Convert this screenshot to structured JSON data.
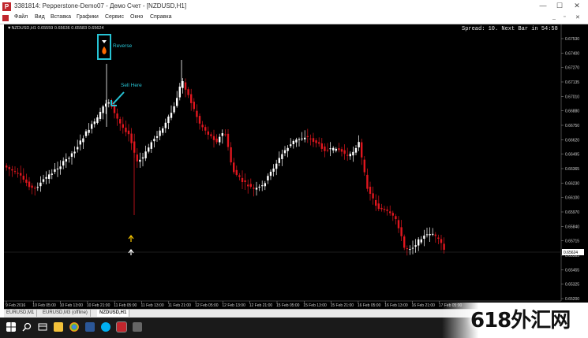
{
  "window": {
    "title": "3381814: Pepperstone-Demo07 - Демо Счет - [NZDUSD,H1]",
    "minimize": "—",
    "maximize": "☐",
    "close": "✕"
  },
  "menu": {
    "items": [
      "Файл",
      "Вид",
      "Вставка",
      "Графики",
      "Сервис",
      "Окно",
      "Справка"
    ],
    "mdi_buttons": [
      "_",
      "▫",
      "✕"
    ]
  },
  "chart": {
    "symbol_info": "▼NZDUSD,H1  0.65559 0.65636 0.65583 0.65624",
    "spread_info": "Spread: 10. Next Bar in 54:58",
    "price_labels": [
      "0.67530",
      "0.67400",
      "0.67270",
      "0.67135",
      "0.67010",
      "0.66880",
      "0.66750",
      "0.66620",
      "0.66495",
      "0.66365",
      "0.66230",
      "0.66100",
      "0.65970",
      "0.65840",
      "0.65715",
      "0.65585",
      "0.65455",
      "0.65325",
      "0.65200"
    ],
    "current_price": "0.65624",
    "time_labels": [
      "9 Feb 2016",
      "10 Feb 05:00",
      "10 Feb 13:00",
      "10 Feb 21:00",
      "11 Feb 05:00",
      "11 Feb 13:00",
      "11 Feb 21:00",
      "12 Feb 05:00",
      "12 Feb 13:00",
      "12 Feb 21:00",
      "15 Feb 05:00",
      "15 Feb 13:00",
      "15 Feb 21:00",
      "16 Feb 05:00",
      "16 Feb 13:00",
      "16 Feb 21:00",
      "17 Feb 05:00"
    ],
    "annotations": {
      "reverse": "Reverse",
      "sell_here": "Sell Here"
    },
    "colors": {
      "background": "#000000",
      "bull": "#ffffff",
      "bear": "#e0161e",
      "annotation": "#27c3d4",
      "grid_text": "#cfcfcf"
    }
  },
  "tabs": [
    {
      "label": "EURUSD,M1",
      "active": false
    },
    {
      "label": "EURUSD,M3 (offline)",
      "active": false
    },
    {
      "label": "NZDUSD,H1",
      "active": true
    }
  ],
  "taskbar": {
    "icons": [
      "windows-icon",
      "search-icon",
      "task-view-icon",
      "file-explorer-icon",
      "chrome-icon",
      "word-icon",
      "skype-icon",
      "terminal-icon",
      "app-icon"
    ]
  },
  "watermark": "618外汇网"
}
